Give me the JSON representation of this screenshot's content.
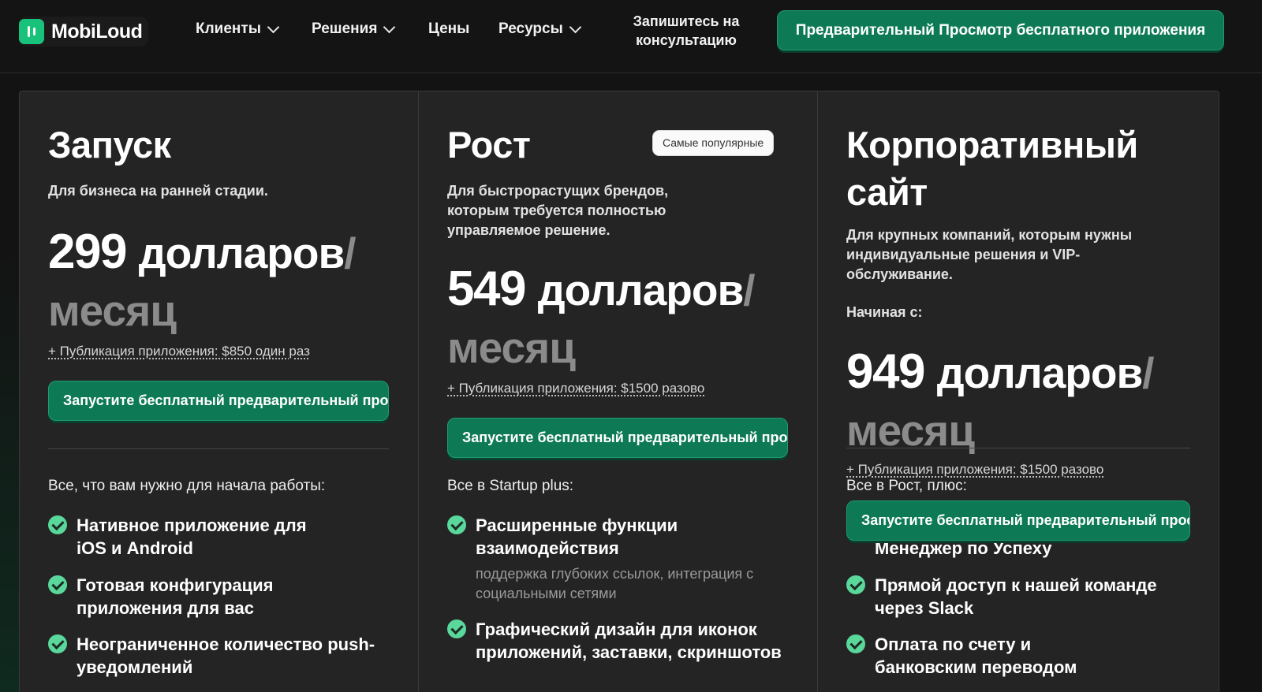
{
  "nav": {
    "logo_text": "MobiLoud",
    "items": [
      {
        "label": "Клиенты",
        "has_dropdown": true
      },
      {
        "label": "Решения",
        "has_dropdown": true
      },
      {
        "label": "Цены",
        "has_dropdown": false
      },
      {
        "label": "Ресурсы",
        "has_dropdown": true
      }
    ],
    "consult_line1": "Запишитесь на",
    "consult_line2": "консультацию",
    "cta_label": "Предварительный Просмотр бесплатного приложения"
  },
  "colors": {
    "accent_green": "#0e7a55",
    "check_green": "#5ad79a",
    "card_bg": "#242424",
    "page_bg": "#131313"
  },
  "plans": [
    {
      "name": "Запуск",
      "description": "Для бизнеса на ранней стадии.",
      "price_number": "299",
      "price_unit": "долларов",
      "price_slash": "/",
      "price_period": "месяц",
      "setup_fee": "+ Публикация приложения: $850 один раз",
      "cta_label": "Запустите бесплатный предварительный просмотр",
      "features_heading": "Все, что вам нужно для начала работы:",
      "features": [
        {
          "title": "Нативное приложение для iOS и Android"
        },
        {
          "title": "Готовая конфигурация приложения для вас"
        },
        {
          "title": "Неограниченное количество push-уведомлений"
        }
      ]
    },
    {
      "name": "Рост",
      "badge": "Самые популярные",
      "description": "Для быстрорастущих брендов, которым требуется полностью управляемое решение.",
      "price_number": "549",
      "price_unit": "долларов",
      "price_slash": "/",
      "price_period": "месяц",
      "setup_fee": "+ Публикация приложения: $1500 разово",
      "cta_label": "Запустите бесплатный предварительный просмотр",
      "features_heading": "Все в Startup plus:",
      "features": [
        {
          "title": "Расширенные функции взаимодействия",
          "subtitle": "поддержка глубоких ссылок, интеграция с социальными сетями"
        },
        {
          "title": "Графический дизайн для иконок приложений, заставки, скриншотов"
        }
      ]
    },
    {
      "name": "Корпоративный сайт",
      "description": "Для крупных компаний, которым нужны индивидуальные решения и VIP-обслуживание.",
      "start_label": "Начиная с:",
      "price_number": "949",
      "price_unit": "долларов",
      "price_slash": "/",
      "price_period": "месяц",
      "setup_fee": "+ Публикация приложения: $1500 разово",
      "cta_label": "Запустите бесплатный предварительный просмотр",
      "features_heading": "Все в Рост, плюс:",
      "features": [
        {
          "title": "Преданный Своему Делу Менеджер по Успеху"
        },
        {
          "title": "Прямой доступ к нашей команде через Slack"
        },
        {
          "title": "Оплата по счету и банковским переводом"
        }
      ]
    }
  ]
}
